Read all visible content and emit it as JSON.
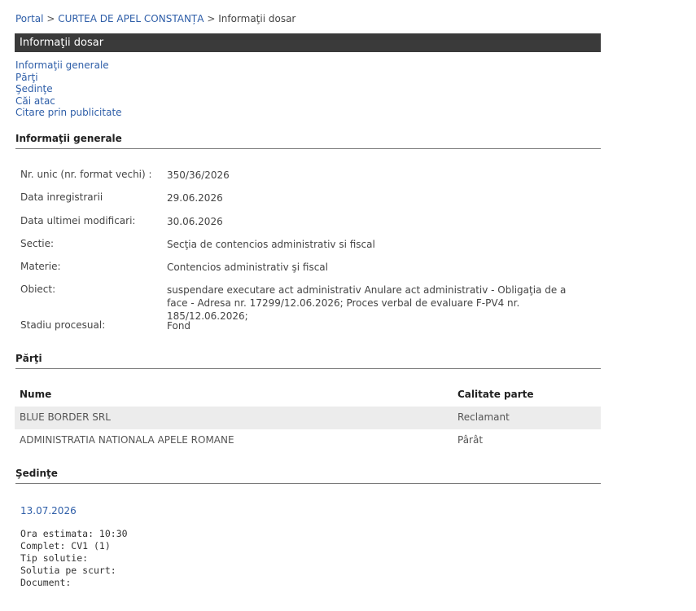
{
  "breadcrumb": {
    "portal": "Portal",
    "sep1": ">",
    "court": "CURTEA DE APEL CONSTANȚA",
    "sep2": ">",
    "current": "Informaţii dosar"
  },
  "title_bar": "Informaţii dosar",
  "nav": {
    "general": "Informaţii generale",
    "parti": "Părţi",
    "sedinte": "Şedinţe",
    "cai_atac": "Căi atac",
    "citare": "Citare prin publicitate"
  },
  "sections": {
    "general": "Informaţii generale",
    "parti": "Părţi",
    "sedinte": "Şedinţe"
  },
  "info": {
    "nr_unic_label": "Nr. unic (nr. format vechi) :",
    "nr_unic_value": "350/36/2026",
    "data_inreg_label": "Data inregistrarii",
    "data_inreg_value": "29.06.2026",
    "data_modif_label": "Data ultimei modificari:",
    "data_modif_value": "30.06.2026",
    "sectie_label": "Sectie:",
    "sectie_value": "Secţia de contencios administrativ si fiscal",
    "materie_label": "Materie:",
    "materie_value": "Contencios administrativ şi fiscal",
    "obiect_label": "Obiect:",
    "obiect_value": "suspendare executare act administrativ Anulare act administrativ - Obligaţia de a face - Adresa nr. 17299/12.06.2026; Proces verbal de evaluare F-PV4 nr. 185/12.06.2026;",
    "stadiu_label": "Stadiu procesual:",
    "stadiu_value": "Fond"
  },
  "parti": {
    "header_name": "Nume",
    "header_role": "Calitate parte",
    "rows": [
      {
        "name": "BLUE BORDER SRL",
        "role": "Reclamant"
      },
      {
        "name": "ADMINISTRATIA NATIONALA APELE ROMANE",
        "role": "Pârât"
      }
    ]
  },
  "sedinta": {
    "date": "13.07.2026",
    "ora": "Ora estimata: 10:30",
    "complet": "Complet: CV1 (1)",
    "tip_solutie": "Tip solutie:",
    "solutia": "Solutia pe scurt:",
    "document": "Document:"
  }
}
